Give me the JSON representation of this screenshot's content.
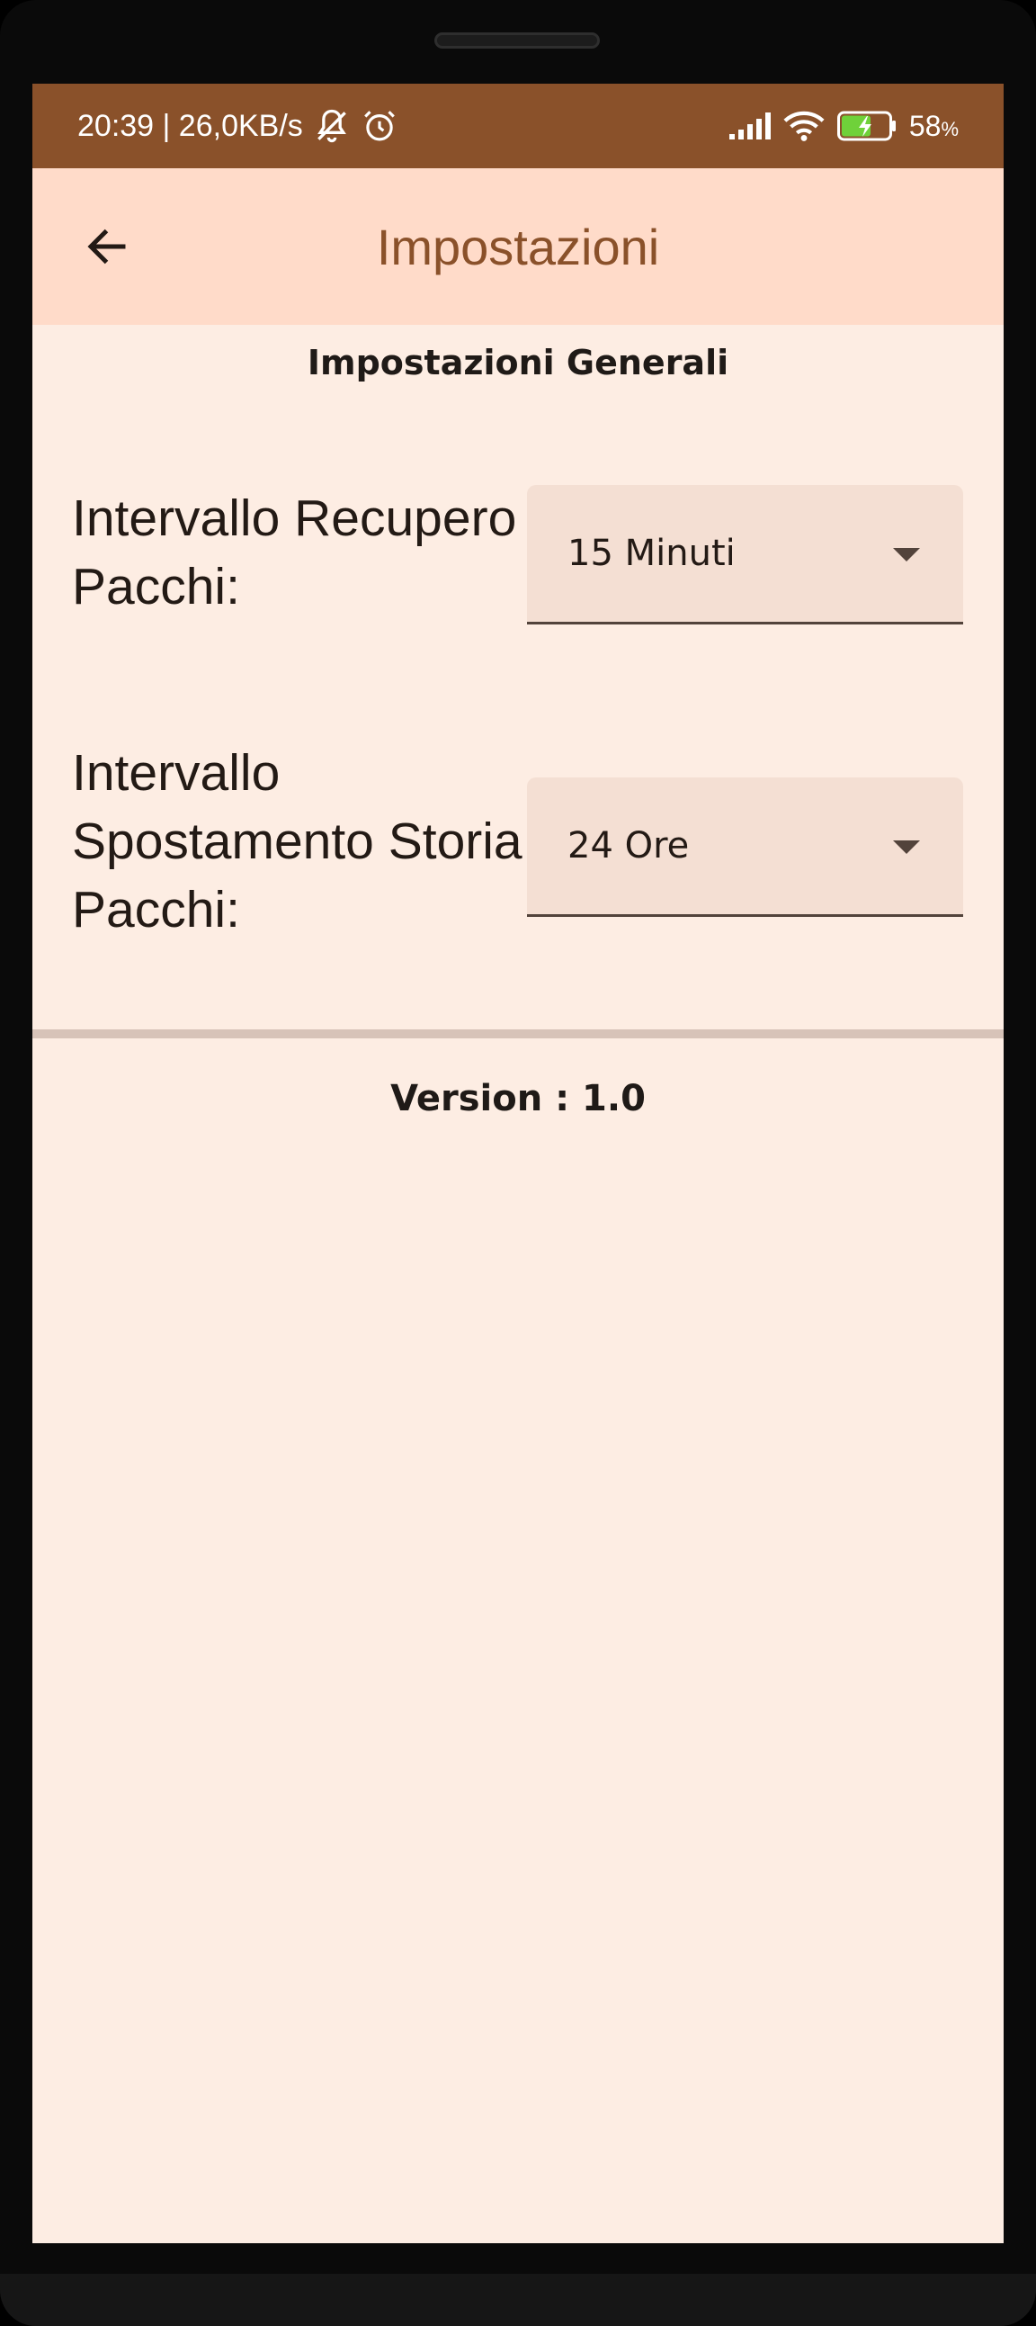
{
  "status_bar": {
    "time_speed": "20:39 | 26,0KB/s",
    "battery_percent": "58",
    "battery_unit": "%",
    "icons": [
      "muted-bell-icon",
      "alarm-icon",
      "signal-icon",
      "wifi-icon",
      "battery-charging-icon"
    ]
  },
  "app_bar": {
    "title": "Impostazioni",
    "back_icon": "arrow-back-icon"
  },
  "content": {
    "section_title": "Impostazioni Generali",
    "settings": [
      {
        "label": "Intervallo Recupero Pacchi:",
        "value": "15 Minuti"
      },
      {
        "label": "Intervallo Spostamento Storia Pacchi:",
        "value": "24 Ore"
      }
    ],
    "version": "Version : 1.0"
  },
  "colors": {
    "status_bar": "#8a512a",
    "app_bar": "#ffdbc9",
    "background": "#fdede3",
    "accent": "#8a512a",
    "dropdown_fill": "#f4dfd3",
    "divider": "#d7c3b8"
  }
}
